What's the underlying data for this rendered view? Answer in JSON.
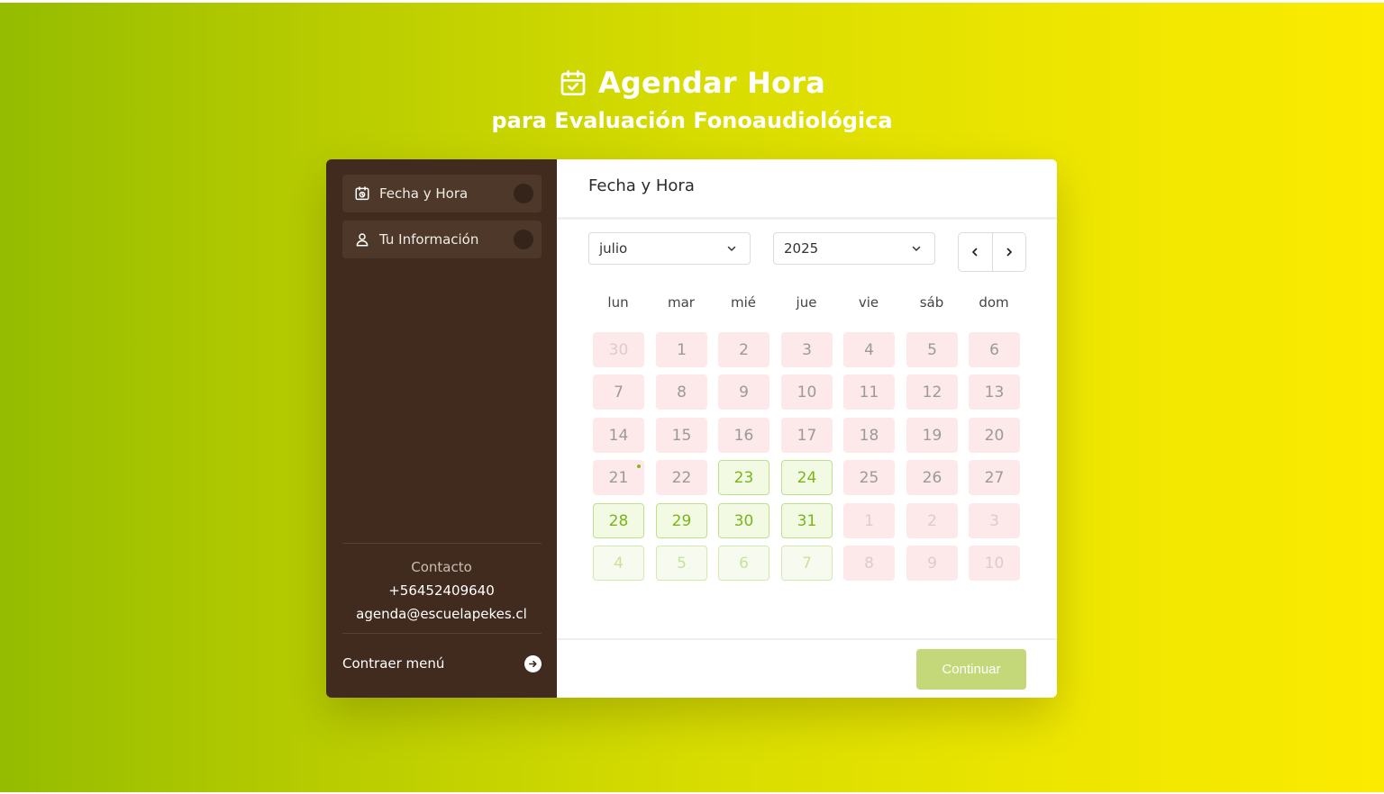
{
  "header": {
    "title": "Agendar Hora",
    "subtitle": "para Evaluación Fonoaudiológica"
  },
  "sidebar": {
    "items": [
      {
        "label": "Fecha y Hora",
        "icon": "calendar-clock-icon"
      },
      {
        "label": "Tu Información",
        "icon": "user-icon"
      }
    ],
    "contact": {
      "label": "Contacto",
      "phone": "+56452409640",
      "email": "agenda@escuelapekes.cl"
    },
    "collapse_label": "Contraer menú"
  },
  "main": {
    "title": "Fecha y Hora",
    "month_select": "julio",
    "year_select": "2025",
    "weekdays": [
      "lun",
      "mar",
      "mié",
      "jue",
      "vie",
      "sáb",
      "dom"
    ],
    "weeks": [
      [
        {
          "d": "30",
          "s": "dis",
          "o": true
        },
        {
          "d": "1",
          "s": "dis"
        },
        {
          "d": "2",
          "s": "dis"
        },
        {
          "d": "3",
          "s": "dis"
        },
        {
          "d": "4",
          "s": "dis"
        },
        {
          "d": "5",
          "s": "dis"
        },
        {
          "d": "6",
          "s": "dis"
        }
      ],
      [
        {
          "d": "7",
          "s": "dis"
        },
        {
          "d": "8",
          "s": "dis"
        },
        {
          "d": "9",
          "s": "dis"
        },
        {
          "d": "10",
          "s": "dis"
        },
        {
          "d": "11",
          "s": "dis"
        },
        {
          "d": "12",
          "s": "dis"
        },
        {
          "d": "13",
          "s": "dis"
        }
      ],
      [
        {
          "d": "14",
          "s": "dis"
        },
        {
          "d": "15",
          "s": "dis"
        },
        {
          "d": "16",
          "s": "dis"
        },
        {
          "d": "17",
          "s": "dis"
        },
        {
          "d": "18",
          "s": "dis"
        },
        {
          "d": "19",
          "s": "dis"
        },
        {
          "d": "20",
          "s": "dis"
        }
      ],
      [
        {
          "d": "21",
          "s": "dis",
          "today": true
        },
        {
          "d": "22",
          "s": "dis"
        },
        {
          "d": "23",
          "s": "av"
        },
        {
          "d": "24",
          "s": "av"
        },
        {
          "d": "25",
          "s": "dis"
        },
        {
          "d": "26",
          "s": "dis"
        },
        {
          "d": "27",
          "s": "dis"
        }
      ],
      [
        {
          "d": "28",
          "s": "av"
        },
        {
          "d": "29",
          "s": "av"
        },
        {
          "d": "30",
          "s": "av"
        },
        {
          "d": "31",
          "s": "av"
        },
        {
          "d": "1",
          "s": "dis",
          "o": true
        },
        {
          "d": "2",
          "s": "dis",
          "o": true
        },
        {
          "d": "3",
          "s": "dis",
          "o": true
        }
      ],
      [
        {
          "d": "4",
          "s": "av",
          "o": true
        },
        {
          "d": "5",
          "s": "av",
          "o": true
        },
        {
          "d": "6",
          "s": "av",
          "o": true
        },
        {
          "d": "7",
          "s": "av",
          "o": true
        },
        {
          "d": "8",
          "s": "dis",
          "o": true
        },
        {
          "d": "9",
          "s": "dis",
          "o": true
        },
        {
          "d": "10",
          "s": "dis",
          "o": true
        }
      ]
    ],
    "continue_label": "Continuar"
  },
  "colors": {
    "sidebar_bg": "#402b1e",
    "available_text": "#7ab51a",
    "unavailable_bg": "#fde8ea",
    "continue_bg": "#c4d879"
  }
}
